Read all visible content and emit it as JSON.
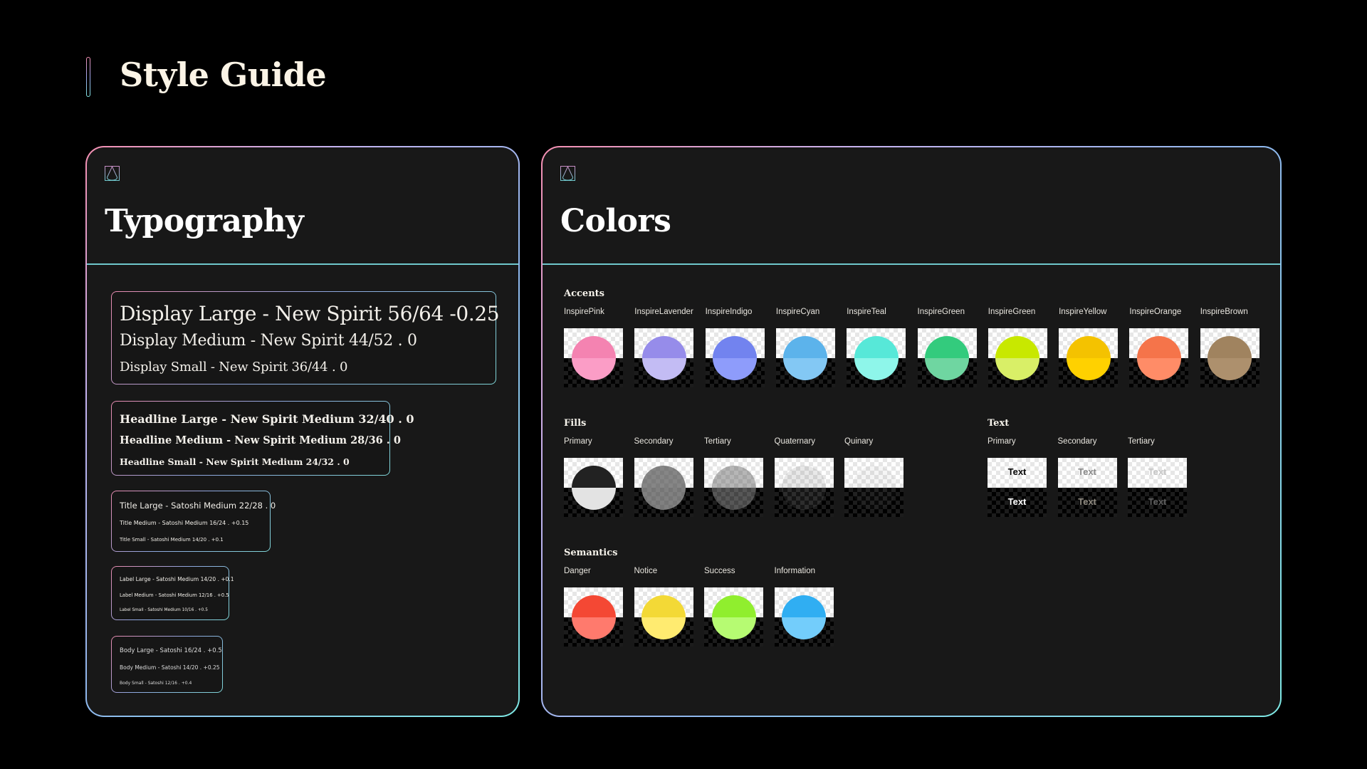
{
  "page": {
    "title": "Style Guide"
  },
  "typography": {
    "title": "Typography",
    "display": [
      "Display Large - New Spirit 56/64 -0.25",
      "Display Medium - New Spirit 44/52 .  0",
      "Display Small - New Spirit 36/44 . 0"
    ],
    "headline": [
      "Headline Large - New Spirit Medium 32/40 . 0",
      "Headline Medium - New Spirit Medium 28/36 . 0",
      "Headline Small - New Spirit Medium 24/32 . 0"
    ],
    "title_styles": [
      "Title Large - Satoshi Medium 22/28 . 0",
      "Title Medium - Satoshi Medium 16/24 . +0.15",
      "Title Small - Satoshi Medium 14/20 . +0.1"
    ],
    "label": [
      "Label Large - Satoshi Medium 14/20 . +0.1",
      "Label Medium - Satoshi Medium 12/16 . +0.5",
      "Label Small - Satoshi Medium 10/16 . +0.5"
    ],
    "body": [
      "Body Large - Satoshi 16/24 . +0.5",
      "Body Medium - Satoshi 14/20 . +0.25",
      "Body Small - Satoshi 12/16 . +0.4"
    ]
  },
  "colors": {
    "title": "Colors",
    "accents": {
      "title": "Accents",
      "items": [
        {
          "name": "InspirePink",
          "light": "#f483b1",
          "dark": "#fb9dc6"
        },
        {
          "name": "InspireLavender",
          "light": "#968cea",
          "dark": "#c3bcf4"
        },
        {
          "name": "InspireIndigo",
          "light": "#7283ef",
          "dark": "#8e9cfb"
        },
        {
          "name": "InspireCyan",
          "light": "#5cb3eb",
          "dark": "#83c8f4"
        },
        {
          "name": "InspireTeal",
          "light": "#57e8d8",
          "dark": "#8ef6ea"
        },
        {
          "name": "InspireGreen",
          "light": "#33cb7d",
          "dark": "#6fd6a1"
        },
        {
          "name": "InspireGreen",
          "light": "#c8e800",
          "dark": "#d9ef67"
        },
        {
          "name": "InspireYellow",
          "light": "#f4c200",
          "dark": "#ffd100"
        },
        {
          "name": "InspireOrange",
          "light": "#f5744a",
          "dark": "#ff8c67"
        },
        {
          "name": "InspireBrown",
          "light": "#a0835f",
          "dark": "#ad906d"
        }
      ]
    },
    "fills": {
      "title": "Fills",
      "items": [
        {
          "name": "Primary",
          "light": "#222222",
          "dark": "#e3e3e3"
        },
        {
          "name": "Secondary",
          "light": "rgba(60,60,60,0.62)",
          "dark": "rgba(190,190,190,0.62)"
        },
        {
          "name": "Tertiary",
          "light": "rgba(80,80,80,0.42)",
          "dark": "rgba(170,170,170,0.42)"
        },
        {
          "name": "Quaternary",
          "light": "rgba(90,90,90,0.14)",
          "dark": "rgba(150,150,150,0.14)"
        },
        {
          "name": "Quinary",
          "light": "rgba(110,110,110,0.07)",
          "dark": "rgba(120,120,120,0.07)"
        }
      ]
    },
    "text": {
      "title": "Text",
      "sample": "Text",
      "items": [
        {
          "name": "Primary",
          "light": "#0a0a0a",
          "dark": "#ffffff"
        },
        {
          "name": "Secondary",
          "light": "#8a8a8a",
          "dark": "#8f8a80"
        },
        {
          "name": "Tertiary",
          "light": "#c6c6c6",
          "dark": "#5e5e5e"
        }
      ]
    },
    "semantics": {
      "title": "Semantics",
      "items": [
        {
          "name": "Danger",
          "light": "#f44834",
          "dark": "#ff7a6d"
        },
        {
          "name": "Notice",
          "light": "#f3d936",
          "dark": "#ffeb70"
        },
        {
          "name": "Success",
          "light": "#90ee2e",
          "dark": "#b6fb72"
        },
        {
          "name": "Information",
          "light": "#30aef2",
          "dark": "#73cdfb"
        }
      ]
    }
  }
}
